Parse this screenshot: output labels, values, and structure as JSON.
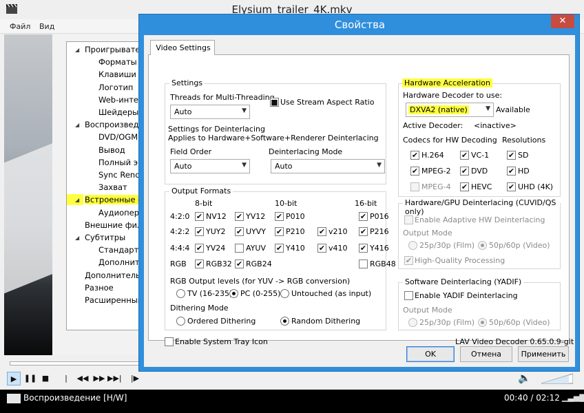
{
  "player": {
    "title": "Elysium_trailer_4K.mkv",
    "menu": [
      "Файл",
      "Вид"
    ],
    "status_text": "Воспроизведение [H/W]",
    "time": "00:40 / 02:12"
  },
  "options_tree": [
    {
      "label": "Проигрывател",
      "indent": 0,
      "arrow": "◢"
    },
    {
      "label": "Форматы",
      "indent": 1
    },
    {
      "label": "Клавиши",
      "indent": 1
    },
    {
      "label": "Логотип",
      "indent": 1
    },
    {
      "label": "Web-интер",
      "indent": 1
    },
    {
      "label": "Шейдеры",
      "indent": 1
    },
    {
      "label": "Воспроизведе",
      "indent": 0,
      "arrow": "◢"
    },
    {
      "label": "DVD/OGM",
      "indent": 1
    },
    {
      "label": "Вывод",
      "indent": 1
    },
    {
      "label": "Полный эк",
      "indent": 1
    },
    {
      "label": "Sync Rende",
      "indent": 1
    },
    {
      "label": "Захват",
      "indent": 1
    },
    {
      "label": "Встроенные ф",
      "indent": 0,
      "arrow": "◢",
      "highlight": true
    },
    {
      "label": "Аудиопере",
      "indent": 1
    },
    {
      "label": "Внешние фил",
      "indent": 0
    },
    {
      "label": "Субтитры",
      "indent": 0,
      "arrow": "◢"
    },
    {
      "label": "Стандартн",
      "indent": 1
    },
    {
      "label": "Дополните",
      "indent": 1
    },
    {
      "label": "Дополнительн",
      "indent": 0
    },
    {
      "label": "Разное",
      "indent": 0
    },
    {
      "label": "Расширенный",
      "indent": 0
    }
  ],
  "dialog": {
    "title": "Свойства",
    "close_glyph": "✕",
    "tab": "Video Settings",
    "settings": {
      "group": "Settings",
      "threads_label": "Threads for Multi-Threading",
      "threads_value": "Auto",
      "stream_aspect": "Use Stream Aspect Ratio",
      "deint_settings": "Settings for Deinterlacing",
      "deint_applies": "Applies to Hardware+Software+Renderer Deinterlacing",
      "field_order_label": "Field Order",
      "field_order_value": "Auto",
      "deint_mode_label": "Deinterlacing Mode",
      "deint_mode_value": "Auto"
    },
    "output": {
      "group": "Output Formats",
      "headers": [
        "8-bit",
        "10-bit",
        "16-bit"
      ],
      "rows": [
        "4:2:0",
        "4:2:2",
        "4:4:4",
        "RGB"
      ],
      "formats": [
        {
          "label": "NV12",
          "checked": true
        },
        {
          "label": "YV12",
          "checked": true
        },
        {
          "label": "P010",
          "checked": true
        },
        {
          "label": "P016",
          "checked": true
        },
        {
          "label": "YUY2",
          "checked": true
        },
        {
          "label": "UYVY",
          "checked": true
        },
        {
          "label": "P210",
          "checked": true
        },
        {
          "label": "v210",
          "checked": true
        },
        {
          "label": "P216",
          "checked": true
        },
        {
          "label": "YV24",
          "checked": true
        },
        {
          "label": "AYUV",
          "checked": false
        },
        {
          "label": "Y410",
          "checked": true
        },
        {
          "label": "v410",
          "checked": true
        },
        {
          "label": "Y416",
          "checked": true
        },
        {
          "label": "RGB32",
          "checked": true
        },
        {
          "label": "RGB24",
          "checked": true
        },
        {
          "label": "RGB48",
          "checked": false
        }
      ],
      "levels_label": "RGB Output levels (for YUV -> RGB conversion)",
      "levels": [
        "TV (16-235)",
        "PC (0-255)",
        "Untouched (as input)"
      ],
      "dither_label": "Dithering Mode",
      "dither": [
        "Ordered Dithering",
        "Random Dithering"
      ]
    },
    "tray": "Enable System Tray Icon",
    "hw": {
      "group": "Hardware Acceleration",
      "decoder_label": "Hardware Decoder to use:",
      "decoder_value": "DXVA2 (native)",
      "available": "Available",
      "active_label": "Active Decoder:",
      "active_value": "<inactive>",
      "codecs_label": "Codecs for HW Decoding",
      "res_label": "Resolutions",
      "codecs": [
        {
          "label": "H.264",
          "checked": true,
          "enabled": true
        },
        {
          "label": "VC-1",
          "checked": true,
          "enabled": true
        },
        {
          "label": "MPEG-2",
          "checked": true,
          "enabled": true
        },
        {
          "label": "DVD",
          "checked": true,
          "enabled": true
        },
        {
          "label": "MPEG-4",
          "checked": false,
          "enabled": false
        },
        {
          "label": "HEVC",
          "checked": true,
          "enabled": true
        }
      ],
      "resolutions": [
        {
          "label": "SD",
          "checked": true
        },
        {
          "label": "HD",
          "checked": true
        },
        {
          "label": "UHD (4K)",
          "checked": true
        }
      ]
    },
    "hwdeint": {
      "group": "Hardware/GPU Deinterlacing (CUVID/QS only)",
      "adaptive": "Enable Adaptive HW Deinterlacing",
      "output_mode": "Output Mode",
      "film": "25p/30p (Film)",
      "video": "50p/60p (Video)",
      "hq": "High-Quality Processing"
    },
    "yadif": {
      "group": "Software Deinterlacing (YADIF)",
      "enable": "Enable YADIF Deinterlacing",
      "output_mode": "Output Mode",
      "film": "25p/30p (Film)",
      "video": "50p/60p (Video)"
    },
    "version": "LAV Video Decoder 0.65.0.9-git",
    "buttons": {
      "ok": "OK",
      "cancel": "Отмена",
      "apply": "Применить"
    }
  }
}
